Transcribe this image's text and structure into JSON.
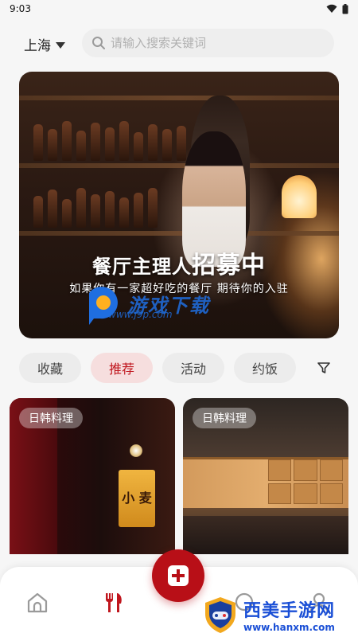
{
  "status_bar": {
    "time": "9:03"
  },
  "header": {
    "city": "上海",
    "search_placeholder": "请输入搜索关键词"
  },
  "banner": {
    "title_part1": "餐厅主理人",
    "title_part2": "招募中",
    "subtitle": "如果你有一家超好吃的餐厅 期待你的入驻"
  },
  "watermark": {
    "text": "游戏下载",
    "url": "www.j9p.com"
  },
  "tabs": [
    {
      "label": "收藏",
      "active": false
    },
    {
      "label": "推荐",
      "active": true
    },
    {
      "label": "活动",
      "active": false
    },
    {
      "label": "约饭",
      "active": false
    }
  ],
  "cards": [
    {
      "badge": "日韩料理",
      "sign_text": "小 麦"
    },
    {
      "badge": "日韩料理"
    }
  ],
  "bottom_watermark": {
    "title": "西美手游网",
    "url": "www.hanxm.com"
  },
  "colors": {
    "accent": "#c0161e",
    "fab": "#b80f17",
    "active_tab_bg": "#f6dede"
  }
}
